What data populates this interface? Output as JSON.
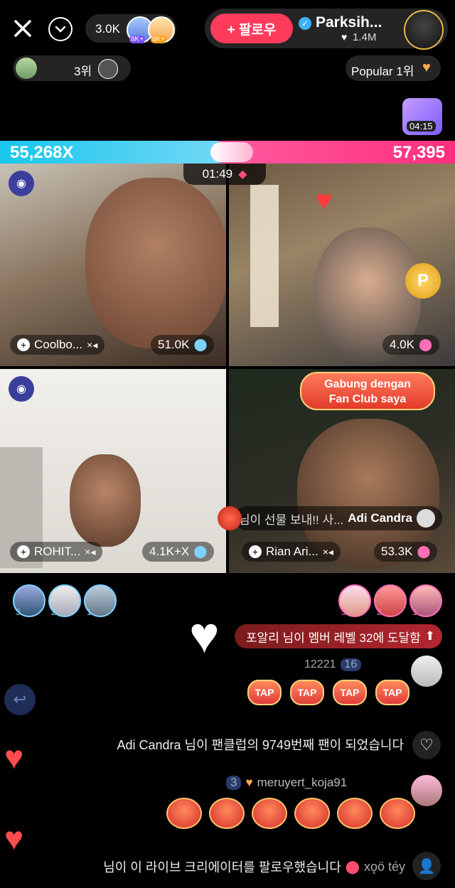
{
  "header": {
    "host_name": "Parksih...",
    "host_likes": "1.4M",
    "follow_label": "+ 팔로우",
    "viewers_count": "3.0K",
    "badge_8k_1": "8K+",
    "badge_8k_2": "8K+",
    "rank_label": "3위",
    "popular_label": "Popular 1위",
    "timer_badge": "04:15"
  },
  "battle": {
    "left_score": "55,268X",
    "right_score": "57,395",
    "countdown": "01:49"
  },
  "tiles": [
    {
      "name": "Coolbo...",
      "score": "51.0K"
    },
    {
      "name": "",
      "score": "4.0K"
    },
    {
      "name": "ROHIT...",
      "score": "4.1K+X"
    },
    {
      "name": "Rian Ari...",
      "score": "53.3K"
    }
  ],
  "overlay": {
    "fan_club_line1": "Gabung dengan",
    "fan_club_line2": "Fan Club saya",
    "gift_msg_user": "Adi Candra",
    "gift_msg_text": "님이 선물 보내!! 사..."
  },
  "rankers": {
    "left": [
      "3",
      "2",
      "1"
    ],
    "right": [
      "3",
      "2",
      "1"
    ]
  },
  "chat": {
    "levelup_msg": "포알리 님이 멤버 레벨 32에 도달함",
    "user_1": "12221",
    "user_1_level": "16",
    "fan_msg": "Adi Candra 님이 팬클럽의 9749번째 팬이 되었습니다",
    "user_2": "meruyert_koja91",
    "user_2_level": "3",
    "follow_msg_user": "xǫö téy",
    "follow_msg_text": "님이 이 라이브 크리에이터를 팔로우했습니다"
  },
  "colors": {
    "follow_btn": "#ff3b5c",
    "score_left": "#2ec4e8",
    "score_right": "#ff2f7d"
  }
}
